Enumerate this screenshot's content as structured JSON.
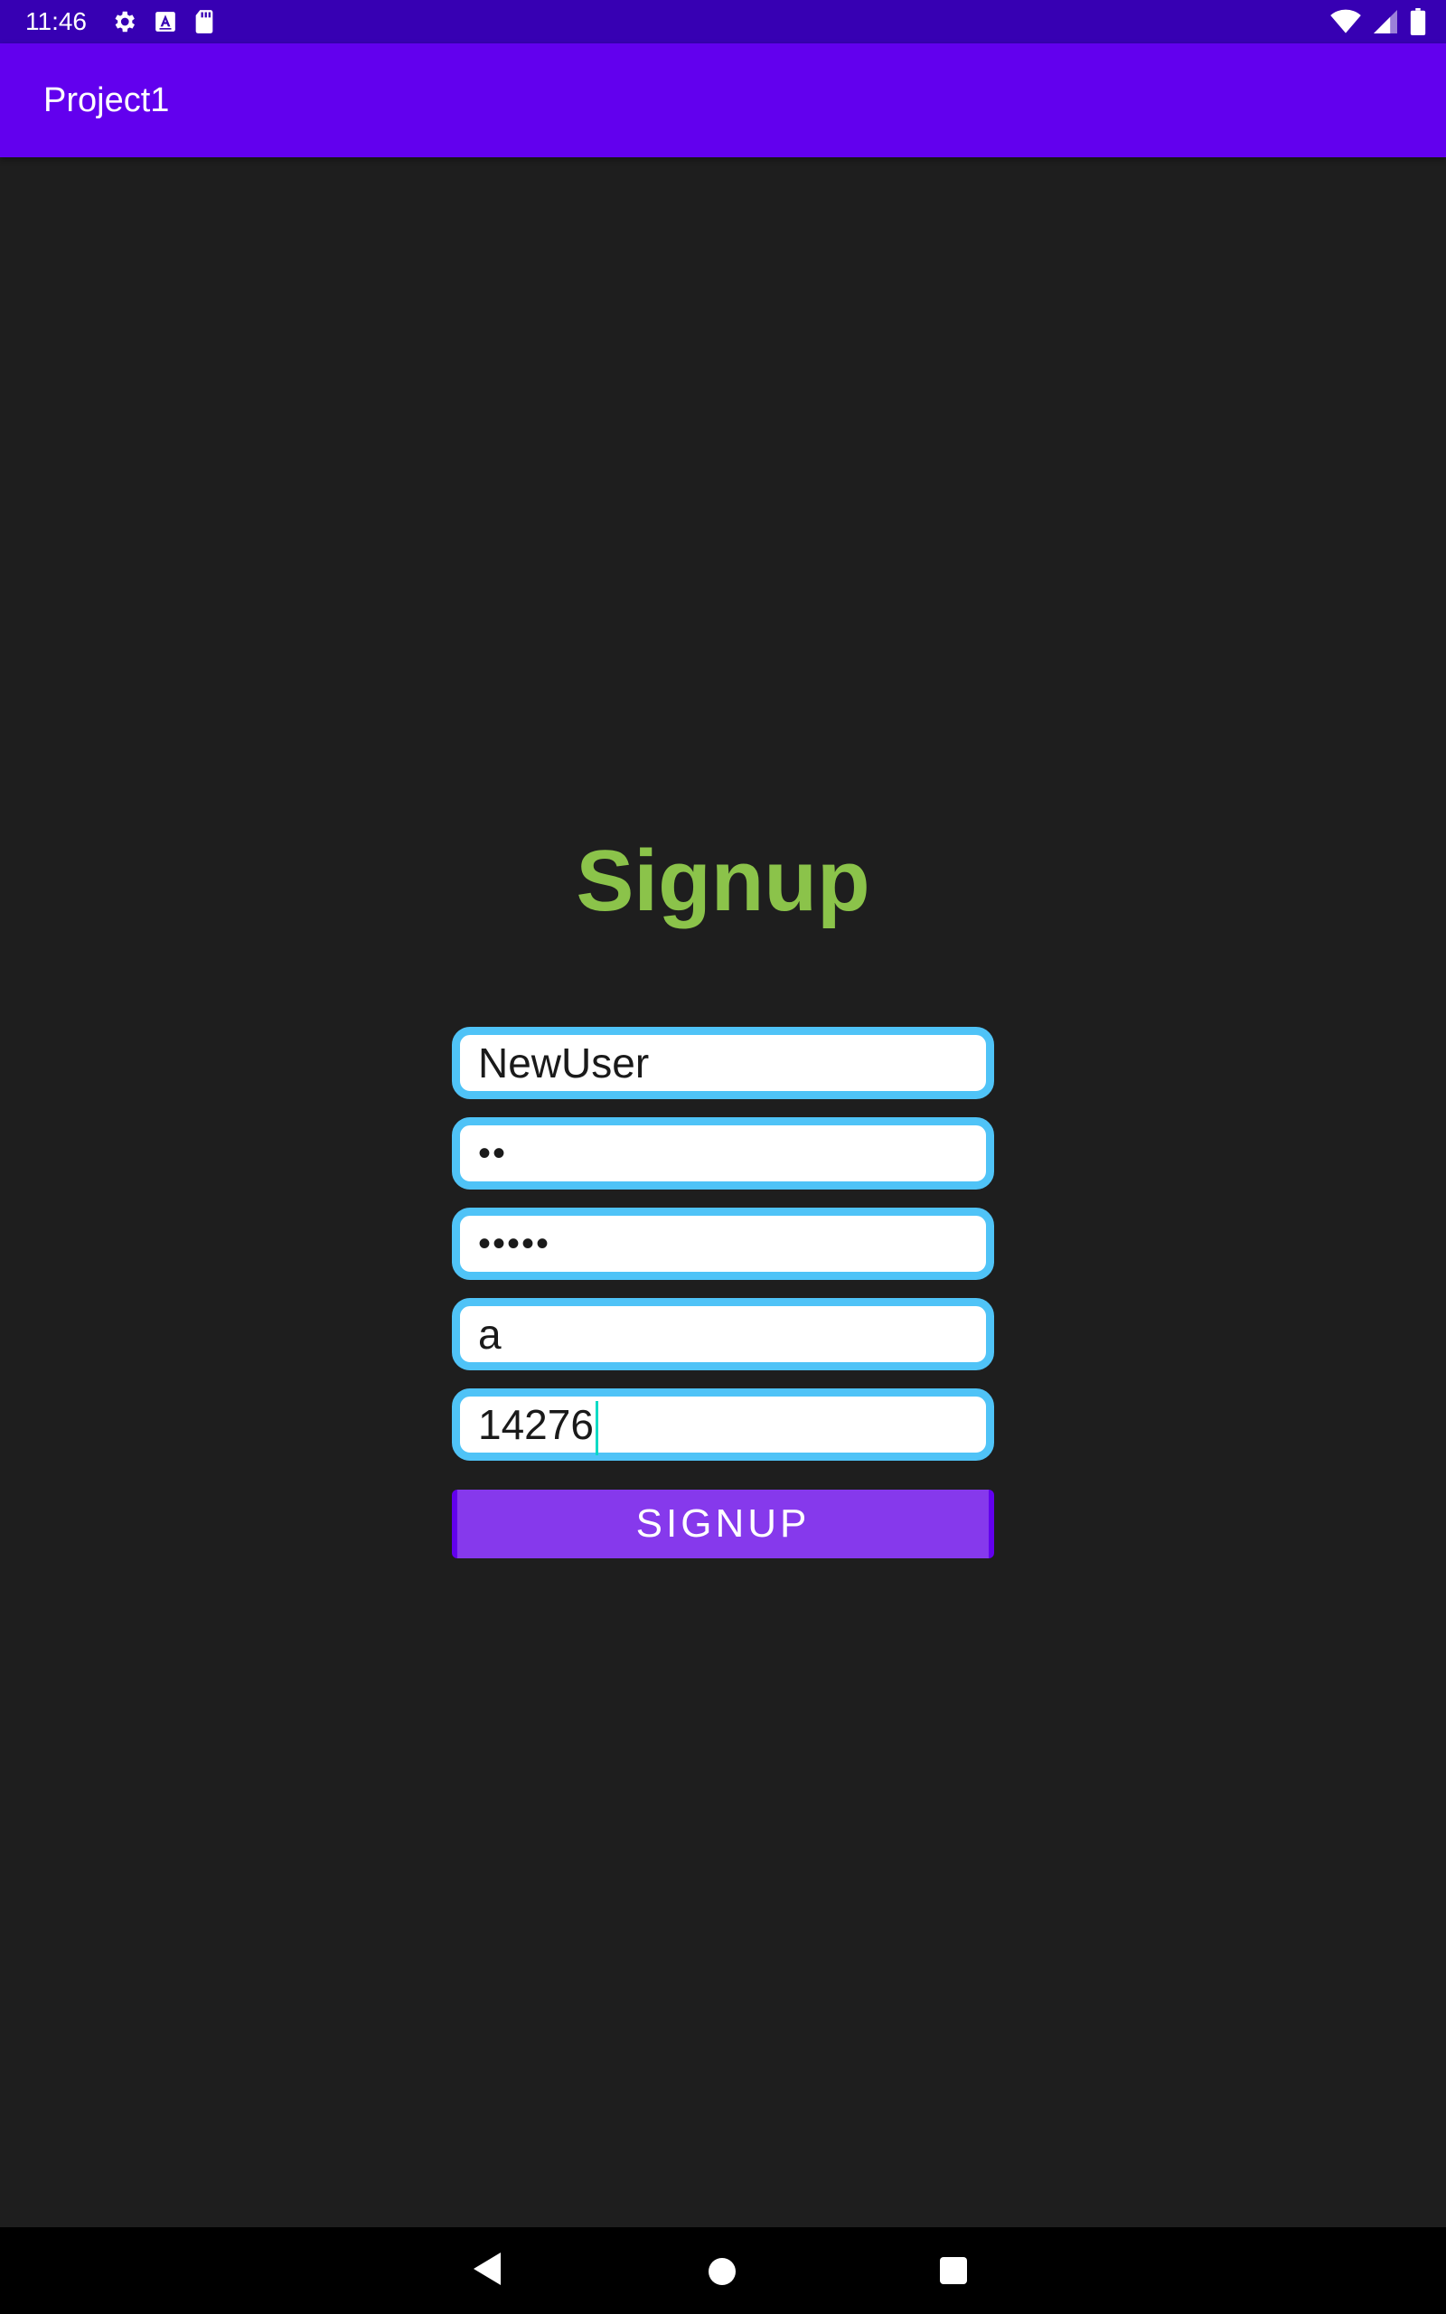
{
  "status_bar": {
    "time": "11:46",
    "icons_left": [
      "gear-icon",
      "a-square-icon",
      "sd-card-icon"
    ],
    "icons_right": [
      "wifi-icon",
      "signal-icon",
      "battery-icon"
    ]
  },
  "app_bar": {
    "title": "Project1"
  },
  "form": {
    "heading": "Signup",
    "fields": [
      {
        "value": "NewUser",
        "masked": false
      },
      {
        "value": "••",
        "masked": true
      },
      {
        "value": "•••••",
        "masked": true
      },
      {
        "value": "a",
        "masked": false
      },
      {
        "value": "14276",
        "masked": false,
        "focused": true
      }
    ],
    "submit_label": "SIGNUP"
  },
  "colors": {
    "status_bar": "#3700b3",
    "app_bar": "#6200ee",
    "heading": "#8bc34a",
    "field_border": "#4fc3f7",
    "button": "#8639ec",
    "background": "#1e1e1e"
  },
  "nav_bar": {
    "icons": [
      "back-icon",
      "home-icon",
      "recents-icon"
    ]
  }
}
